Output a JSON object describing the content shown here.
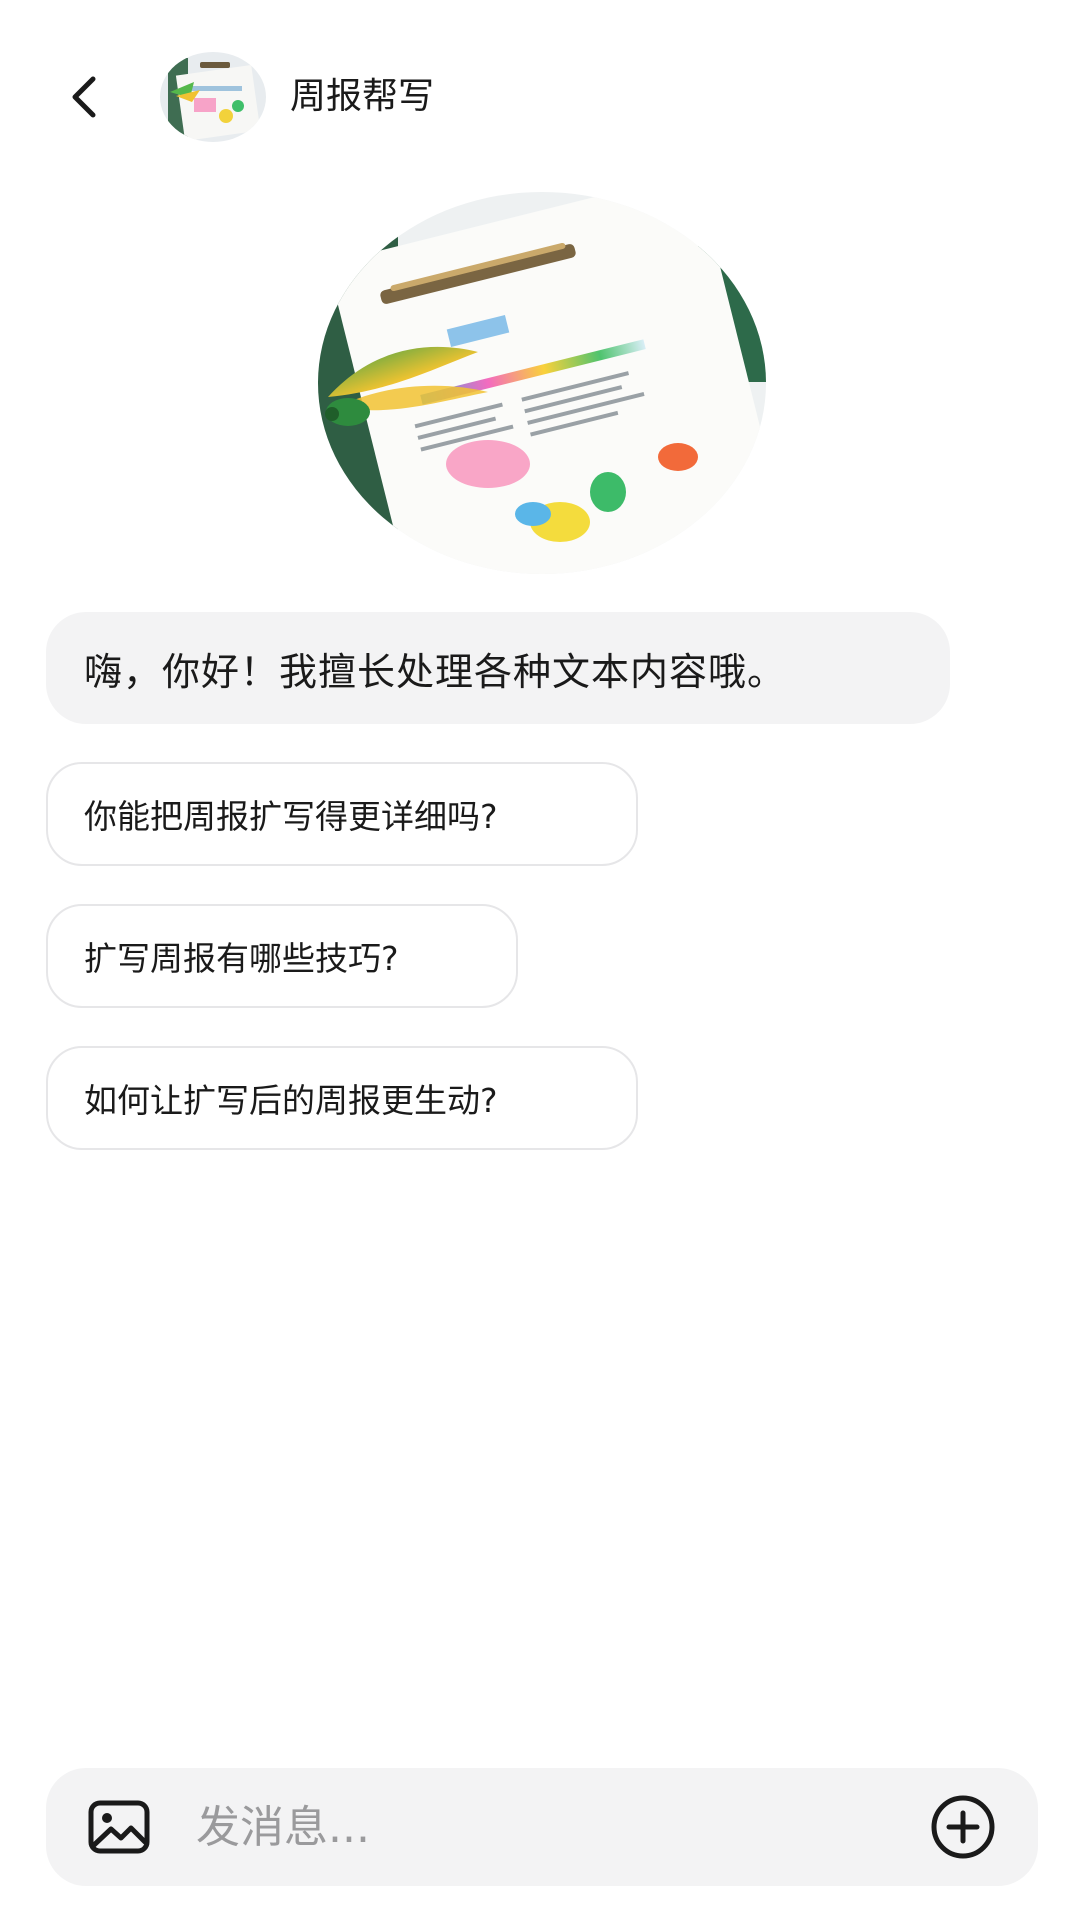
{
  "header": {
    "back_icon": "chevron-left-icon",
    "title": "周报帮写"
  },
  "greeting": "嗨，你好！我擅长处理各种文本内容哦。",
  "suggestions": [
    "你能把周报扩写得更详细吗?",
    "扩写周报有哪些技巧?",
    "如何让扩写后的周报更生动?"
  ],
  "composer": {
    "image_icon": "image-icon",
    "placeholder": "发消息...",
    "plus_icon": "plus-circle-icon"
  },
  "colors": {
    "bubble_bg": "#f3f3f4",
    "border": "#e6e6e8",
    "placeholder": "#9a9a9c",
    "text": "#1a1a1a"
  }
}
